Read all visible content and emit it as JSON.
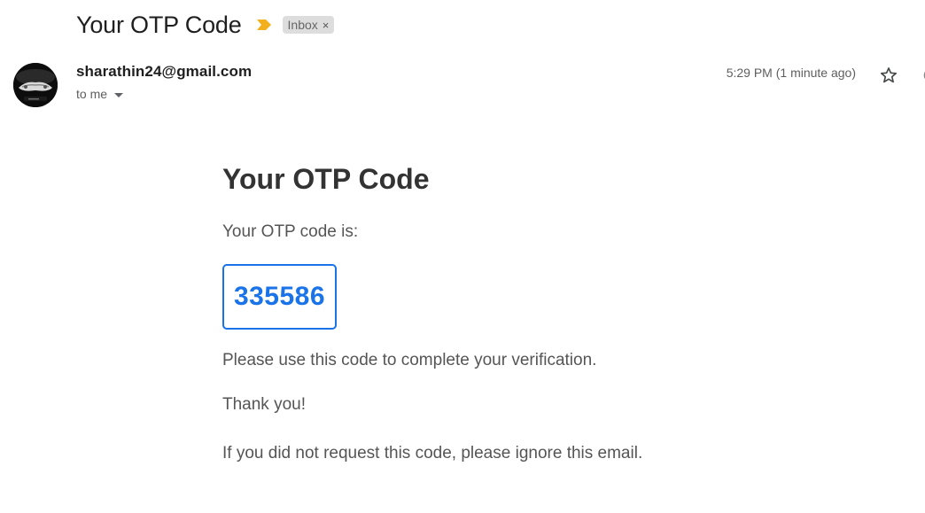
{
  "header": {
    "subject": "Your OTP Code",
    "importance_icon": "importance-marker-icon",
    "importance_color": "#f2b01e",
    "label": "Inbox",
    "label_close": "×"
  },
  "sender": {
    "email": "sharathin24@gmail.com",
    "recipient": "to me",
    "timestamp": "5:29 PM (1 minute ago)",
    "avatar_icon": "avatar-photo"
  },
  "actions": {
    "star_icon": "star-icon",
    "more_icon": "more-vert-icon"
  },
  "body": {
    "title": "Your OTP Code",
    "intro": "Your OTP code is:",
    "otp_code": "335586",
    "instruction": "Please use this code to complete your verification.",
    "thanks": "Thank you!",
    "disclaimer": "If you did not request this code, please ignore this email.",
    "accent_color": "#1a73e8"
  }
}
